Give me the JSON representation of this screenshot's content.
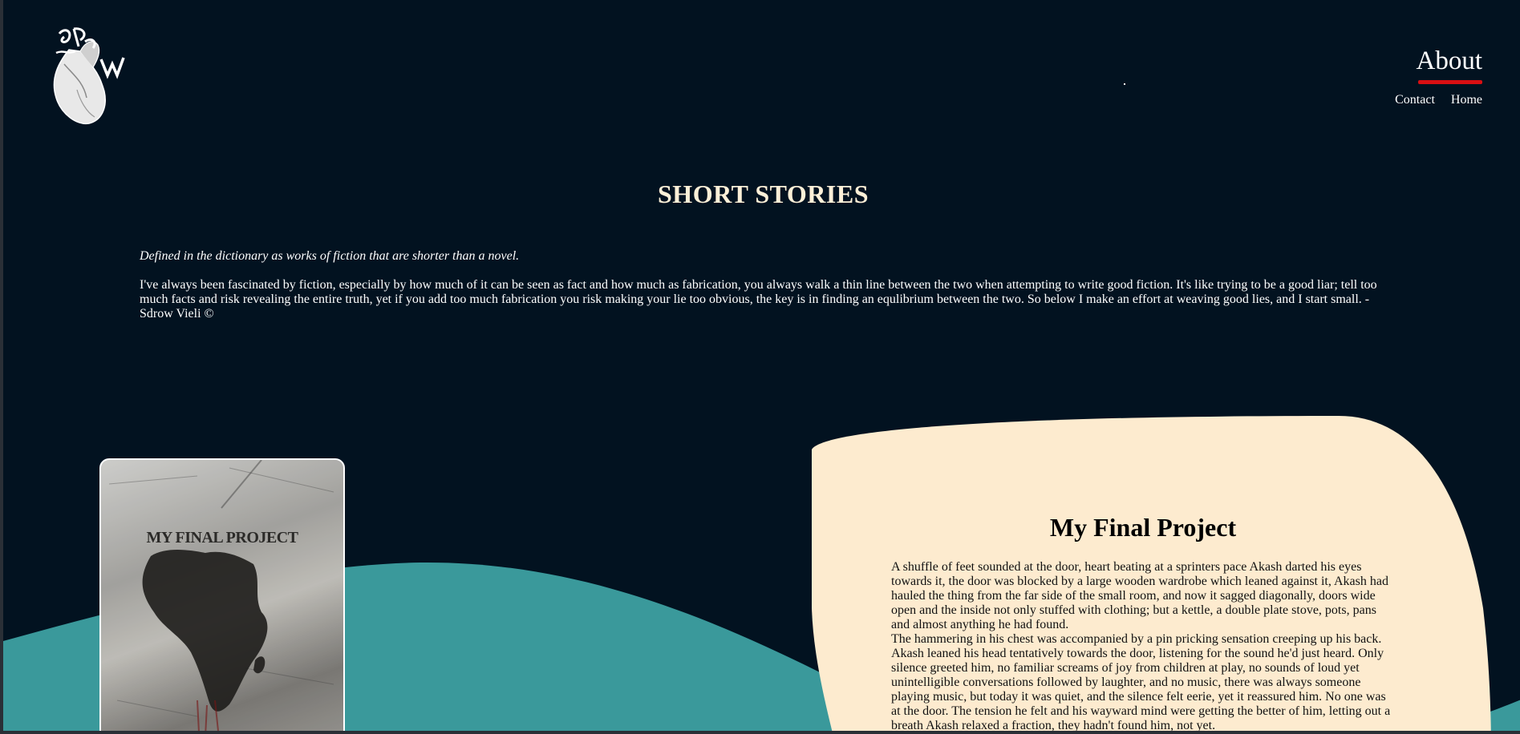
{
  "nav": {
    "about_label": "About",
    "contact_label": "Contact",
    "home_label": "Home",
    "logo_icon": "heart-logo-icon",
    "accent_color": "#d90f12"
  },
  "page": {
    "title": "SHORT STORIES",
    "intro_tagline": "Defined in the dictionary as works of fiction that are shorter than a novel.",
    "intro_body": "I've always been fascinated by fiction, especially by how much of it can be seen as fact and how much as fabrication, you always walk a thin line between the two when attempting to write good fiction. It's like trying to be a good liar; tell too much facts and risk revealing the entire truth, yet if you add too much fabrication you risk making your lie too obvious, the key is in finding an equlibrium between the two. So below I make an effort at weaving good lies, and I start small. - Sdrow Vieli ©"
  },
  "story": {
    "cover_title": "MY FINAL PROJECT",
    "title": "My Final Project",
    "paragraph_1": "A shuffle of feet sounded at the door, heart beating at a sprinters pace Akash darted his eyes towards it, the door was blocked by a large wooden wardrobe which leaned against it, Akash had hauled the thing from the far side of the small room, and now it sagged diagonally, doors wide open and the inside not only stuffed with clothing; but a kettle, a double plate stove, pots, pans and almost anything he had found.",
    "paragraph_2": "The hammering in his chest was accompanied by a pin pricking sensation creeping up his back. Akash leaned his head tentatively towards the door, listening for the sound he'd just heard. Only silence greeted him, no familiar screams of joy from children at play, no sounds of loud yet unintelligible conversations followed by laughter, and no music, there was always someone playing music, but today it was quiet, and the silence felt eerie, yet it reassured him. No one was at the door. The tension he felt and his wayward mind were getting the better of him, letting out a breath Akash relaxed a fraction, they hadn't found him, not yet."
  },
  "colors": {
    "background": "#021220",
    "wave": "#3a999b",
    "card": "#fdebcf"
  }
}
